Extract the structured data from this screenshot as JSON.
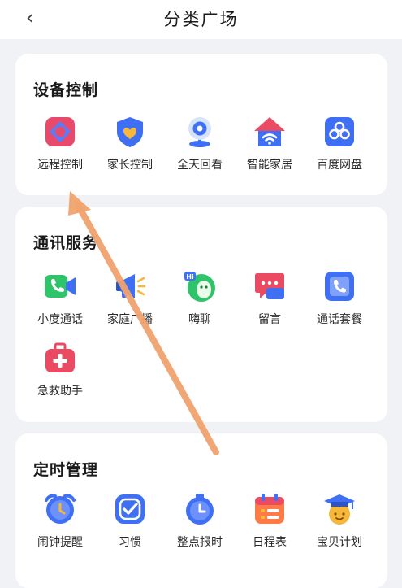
{
  "header": {
    "back_icon": "chevron-left-icon",
    "back_glyph": "‹",
    "title": "分类广场"
  },
  "sections": {
    "device": {
      "title": "设备控制",
      "items": [
        {
          "label": "远程控制",
          "icon": "remote-control-icon"
        },
        {
          "label": "家长控制",
          "icon": "parental-shield-icon"
        },
        {
          "label": "全天回看",
          "icon": "camera-icon"
        },
        {
          "label": "智能家居",
          "icon": "smart-home-icon"
        },
        {
          "label": "百度网盘",
          "icon": "cloud-drive-icon"
        }
      ]
    },
    "comm": {
      "title": "通讯服务",
      "items": [
        {
          "label": "小度通话",
          "icon": "video-call-icon"
        },
        {
          "label": "家庭广播",
          "icon": "megaphone-icon"
        },
        {
          "label": "嗨聊",
          "icon": "chat-bubble-icon"
        },
        {
          "label": "留言",
          "icon": "message-icon"
        },
        {
          "label": "通话套餐",
          "icon": "phone-plan-icon"
        },
        {
          "label": "急救助手",
          "icon": "first-aid-icon"
        }
      ]
    },
    "timer": {
      "title": "定时管理",
      "items": [
        {
          "label": "闹钟提醒",
          "icon": "alarm-clock-icon"
        },
        {
          "label": "习惯",
          "icon": "habit-check-icon"
        },
        {
          "label": "整点报时",
          "icon": "hourly-clock-icon"
        },
        {
          "label": "日程表",
          "icon": "calendar-icon"
        },
        {
          "label": "宝贝计划",
          "icon": "graduation-cap-icon"
        }
      ]
    }
  },
  "annotation": {
    "type": "arrow",
    "color": "#f0a36e"
  }
}
